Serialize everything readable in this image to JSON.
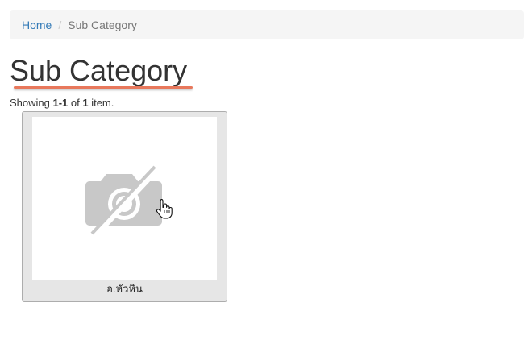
{
  "breadcrumb": {
    "home_label": "Home",
    "separator": "/",
    "current_label": "Sub Category"
  },
  "page": {
    "title": "Sub Category"
  },
  "summary": {
    "prefix": "Showing ",
    "range": "1-1",
    "middle": " of ",
    "total": "1",
    "suffix": " item."
  },
  "items": [
    {
      "label": "อ.หัวหิน",
      "image_icon": "no-image-camera-icon"
    }
  ],
  "colors": {
    "link": "#337ab7",
    "title_underline": "#e8785c",
    "card_background": "#e6e6e6",
    "placeholder_icon": "#c8c8c8"
  }
}
